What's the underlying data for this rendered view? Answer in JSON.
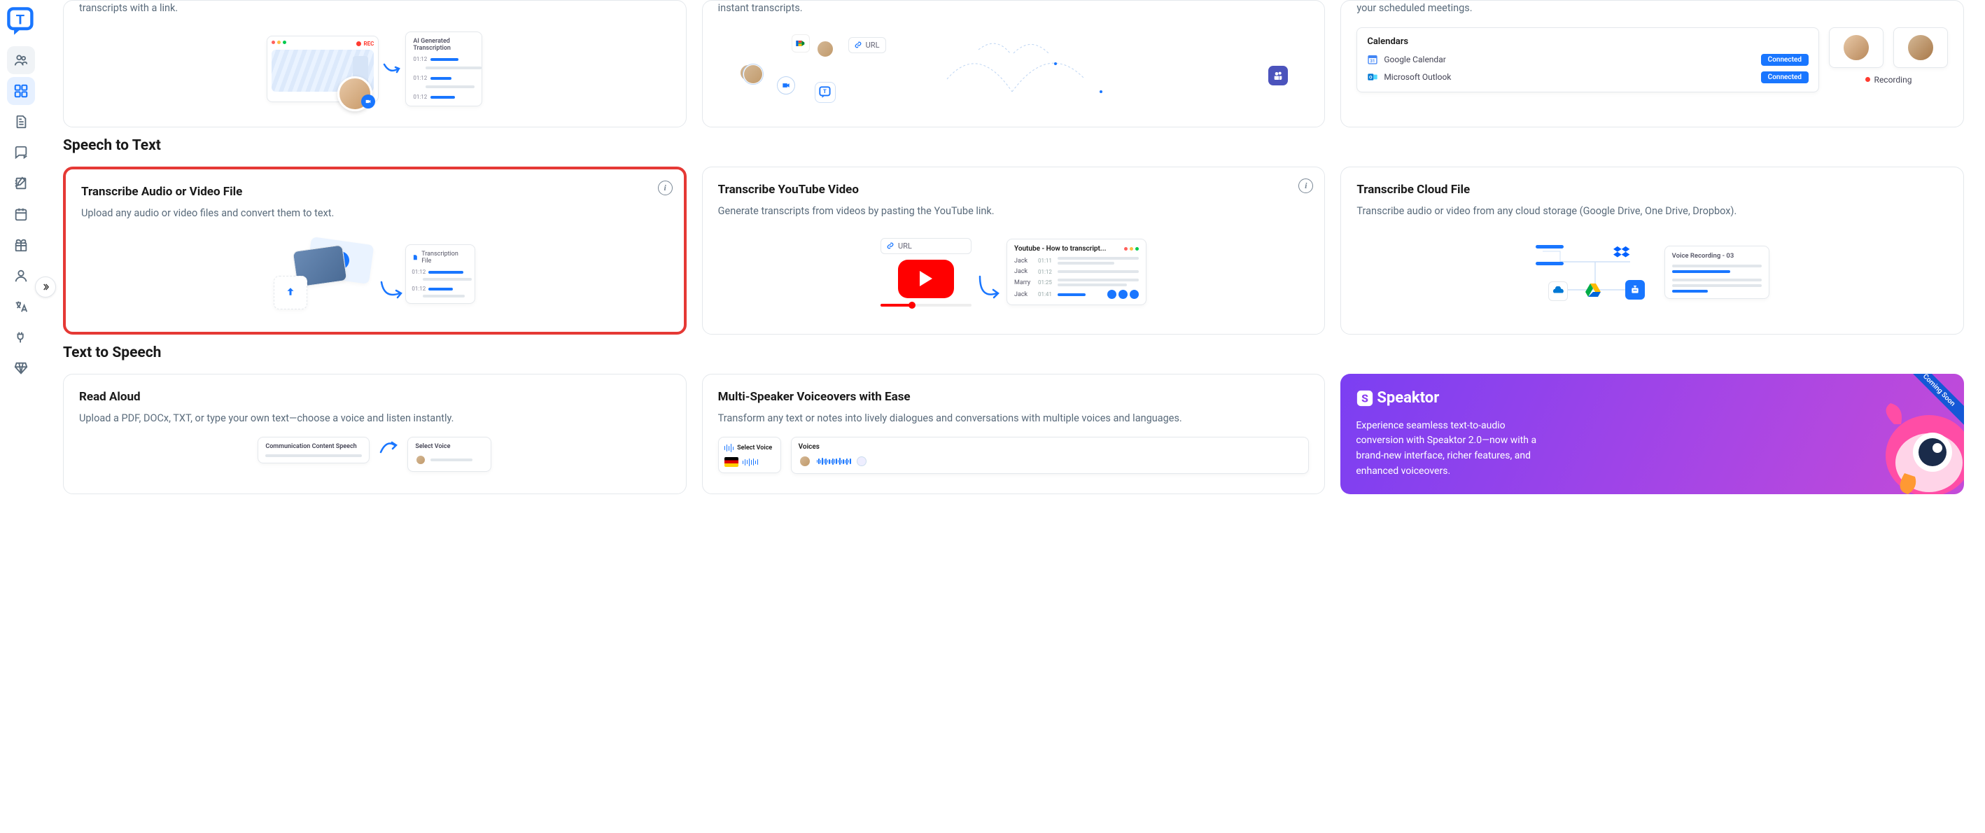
{
  "sidebar": {
    "expand_label": "expand"
  },
  "partial_descs": {
    "card1": "transcripts with a link.",
    "card2": "instant transcripts.",
    "card3": "your scheduled meetings."
  },
  "record_illus": {
    "header": "AI Generated Transcription",
    "rec_label": "REC",
    "time1": "01:12",
    "time2": "01:12",
    "time3": "01:12"
  },
  "url_chip": "URL",
  "calendars": {
    "heading": "Calendars",
    "google": "Google Calendar",
    "outlook": "Microsoft Outlook",
    "connected": "Connected",
    "recording": "Recording"
  },
  "sections": {
    "speech_to_text": "Speech to Text",
    "text_to_speech": "Text to Speech"
  },
  "stt": {
    "file": {
      "title": "Transcribe Audio or Video File",
      "desc": "Upload any audio or video files and convert them to text.",
      "file_chip": "Transcription File",
      "t1": "01:12",
      "t2": "01:12"
    },
    "youtube": {
      "title": "Transcribe YouTube Video",
      "desc": "Generate transcripts from videos by pasting the YouTube link.",
      "panel_title": "Youtube - How to transcript...",
      "r1_name": "Jack",
      "r1_time": "01:11",
      "r2_name": "Jack",
      "r2_time": "01:12",
      "r3_name": "Marry",
      "r3_time": "01:25",
      "r4_name": "Jack",
      "r4_time": "01:41"
    },
    "cloud": {
      "title": "Transcribe Cloud File",
      "desc": "Transcribe audio or video from any cloud storage (Google Drive, One Drive, Dropbox).",
      "rec_label": "Voice Recording - 03"
    }
  },
  "tts": {
    "read": {
      "title": "Read Aloud",
      "desc": "Upload a PDF, DOCx, TXT, or type your own text—choose a voice and listen instantly.",
      "doc_label": "Communication Content Speech",
      "select_voice": "Select Voice"
    },
    "multi": {
      "title": "Multi-Speaker Voiceovers with Ease",
      "desc": "Transform any text or notes into lively dialogues and conversations with multiple voices and languages.",
      "select_voice": "Select Voice",
      "voices_label": "Voices"
    },
    "speaktor": {
      "brand": "Speaktor",
      "ribbon": "Coming Soon",
      "desc": "Experience seamless text-to-audio conversion with Speaktor 2.0—now with a brand-new interface, richer features, and enhanced voiceovers."
    }
  }
}
